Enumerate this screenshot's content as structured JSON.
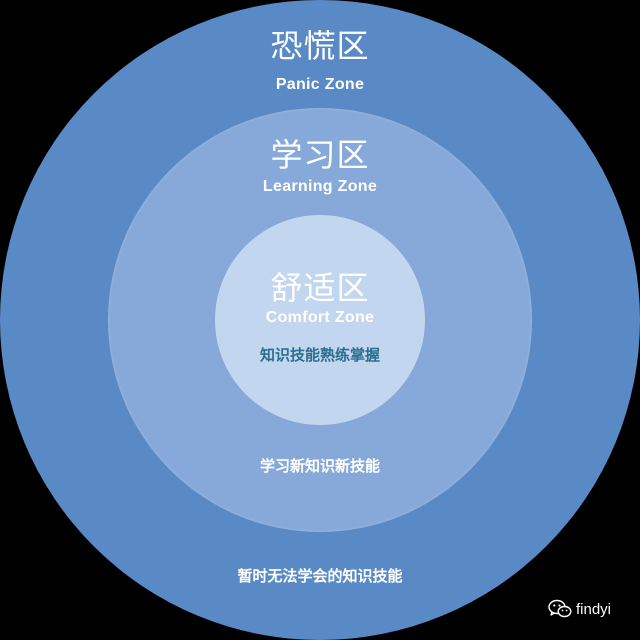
{
  "diagram": {
    "panic": {
      "title_zh": "恐慌区",
      "title_en": "Panic Zone",
      "description": "暂时无法学会的知识技能",
      "color": "#5a8ac6"
    },
    "learning": {
      "title_zh": "学习区",
      "title_en": "Learning Zone",
      "description": "学习新知识新技能",
      "color": "#86a9da"
    },
    "comfort": {
      "title_zh": "舒适区",
      "title_en": "Comfort Zone",
      "description": "知识技能熟练掌握",
      "color": "#c3d6f0",
      "description_color": "#2b6f8f"
    },
    "background_color": "#000000"
  },
  "watermark": {
    "icon": "wechat-icon",
    "text": "findyi"
  }
}
